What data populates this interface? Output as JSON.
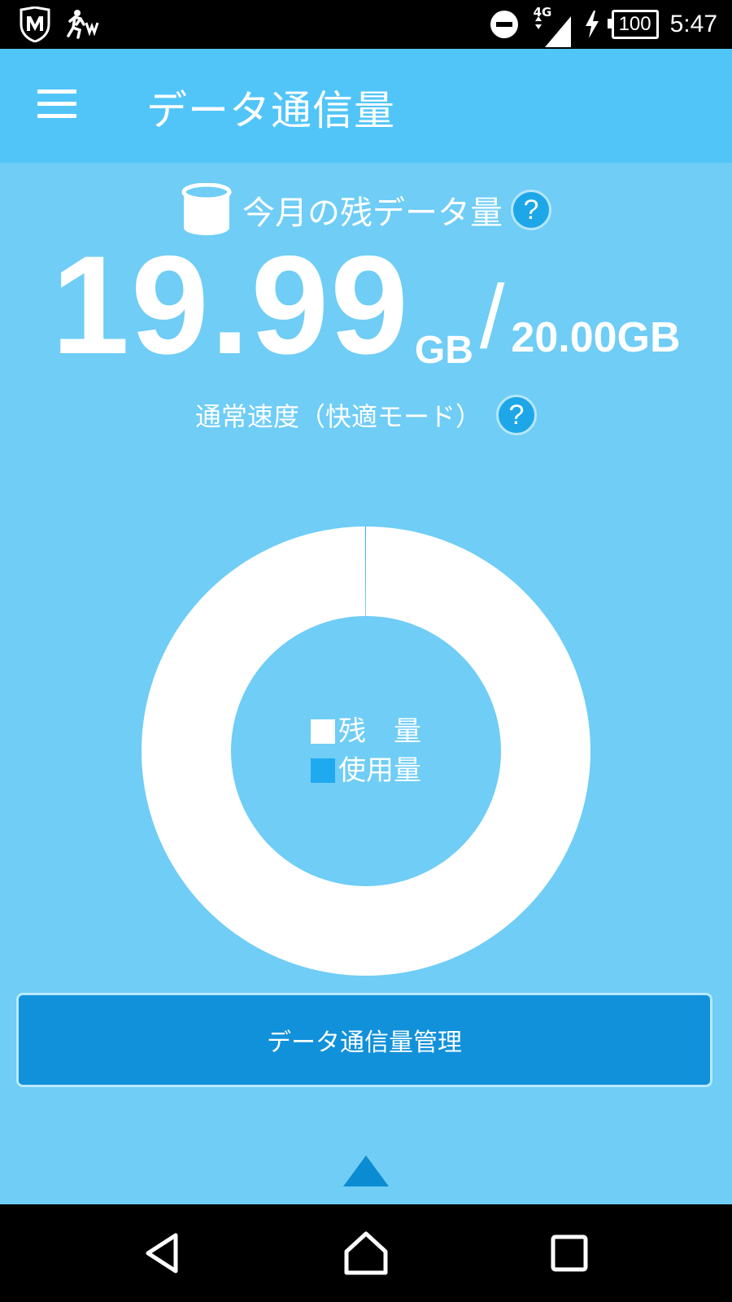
{
  "status_bar": {
    "network": "4G",
    "battery": "100",
    "time": "5:47",
    "icons": [
      "mcafee-shield-icon",
      "running-man-icon",
      "dnd-icon",
      "signal-icon",
      "charging-icon",
      "battery-icon"
    ]
  },
  "app_bar": {
    "title": "データ通信量",
    "menu_icon": "hamburger-icon"
  },
  "remaining": {
    "label": "今月の残データ量",
    "value": "19.99",
    "unit": "GB",
    "separator": "/",
    "total": "20.00GB",
    "speed_mode": "通常速度（快適モード）"
  },
  "chart_data": {
    "type": "pie",
    "labels": [
      "残　量",
      "使用量"
    ],
    "values": [
      19.99,
      0.01
    ],
    "colors": [
      "#ffffff",
      "#1faaf0"
    ]
  },
  "colors": {
    "background": "#6fcdf6",
    "app_bar": "#52c5f8",
    "button": "#1191da",
    "accent": "#1ea7e8"
  },
  "manage_button": {
    "label": "データ通信量管理"
  },
  "nav": [
    "back-icon",
    "home-icon",
    "recents-icon"
  ]
}
